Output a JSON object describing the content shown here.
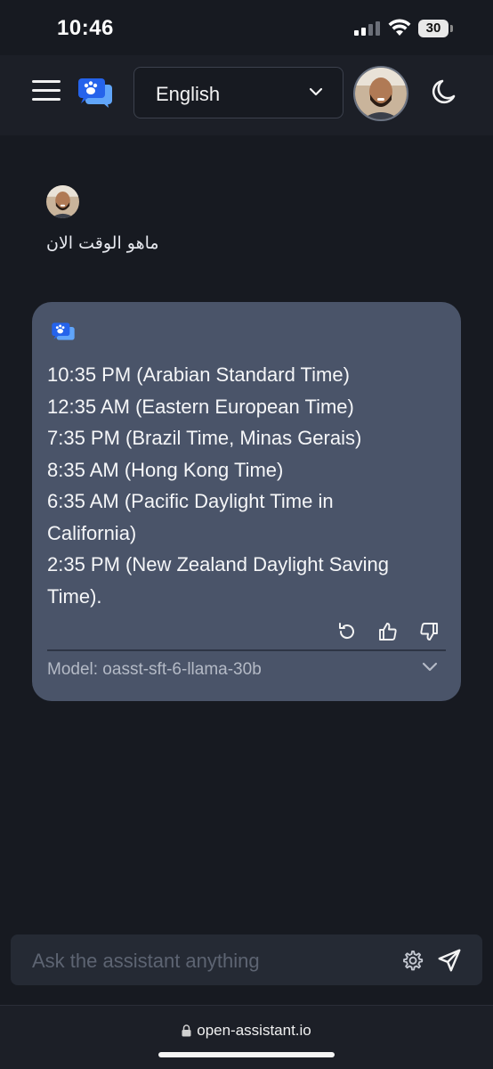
{
  "status_bar": {
    "time": "10:46",
    "battery": "30"
  },
  "header": {
    "language": "English"
  },
  "user_message": {
    "text": "ماهو الوقت الان"
  },
  "assistant_message": {
    "lines": [
      "10:35 PM (Arabian Standard Time)",
      "12:35 AM (Eastern European Time)",
      "7:35 PM (Brazil Time, Minas Gerais)",
      "8:35 AM (Hong Kong Time)",
      "6:35 AM (Pacific Daylight Time in",
      "California)",
      "2:35 PM (New Zealand Daylight Saving",
      "Time)."
    ],
    "model": "Model: oasst-sft-6-llama-30b"
  },
  "composer": {
    "placeholder": "Ask the assistant anything"
  },
  "browser": {
    "url": "open-assistant.io"
  },
  "colors": {
    "background": "#171a21",
    "header": "#1c1f27",
    "assistant_card": "#4a5469",
    "logo_blue": "#3b82f6"
  },
  "icons": [
    "menu-icon",
    "logo-icon",
    "chevron-down-icon",
    "moon-icon",
    "refresh-icon",
    "thumbs-up-icon",
    "thumbs-down-icon",
    "gear-icon",
    "send-icon",
    "lock-icon"
  ]
}
